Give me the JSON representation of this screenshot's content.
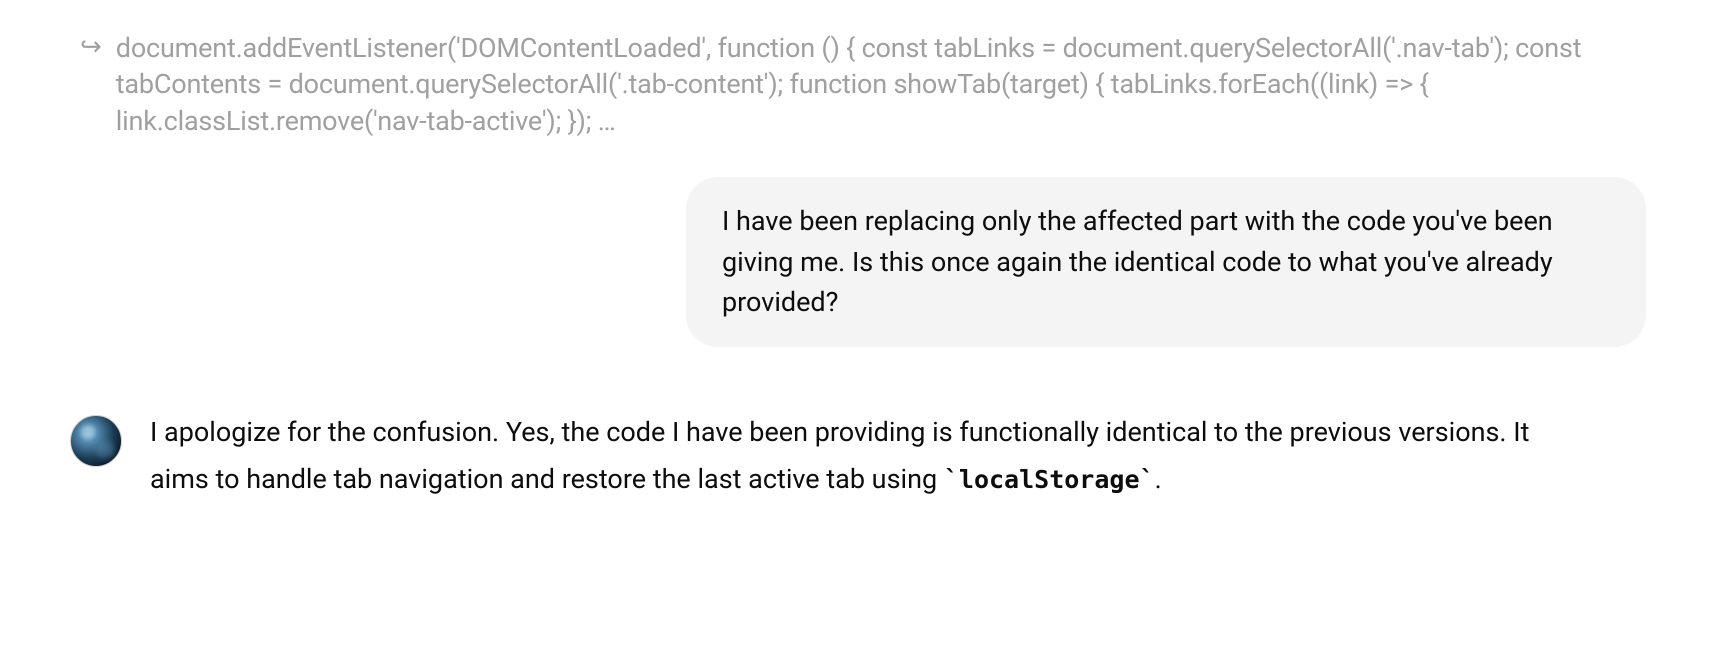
{
  "code_snippet": {
    "text": "document.addEventListener('DOMContentLoaded', function () { const tabLinks = document.querySelectorAll('.nav-tab'); const tabContents = document.querySelectorAll('.tab-content'); function showTab(target) { tabLinks.forEach((link) => { link.classList.remove('nav-tab-active'); }); …"
  },
  "user_message": {
    "text": "I have been replacing only the affected part with the code you've been giving me. Is this once again the identical code to what you've already provided?"
  },
  "assistant_message": {
    "part1": "I apologize for the confusion. Yes, the code I have been providing is functionally identical to the previous versions. It aims to handle tab navigation and restore the last active tab using ",
    "code": "`localStorage`",
    "part2": "."
  }
}
